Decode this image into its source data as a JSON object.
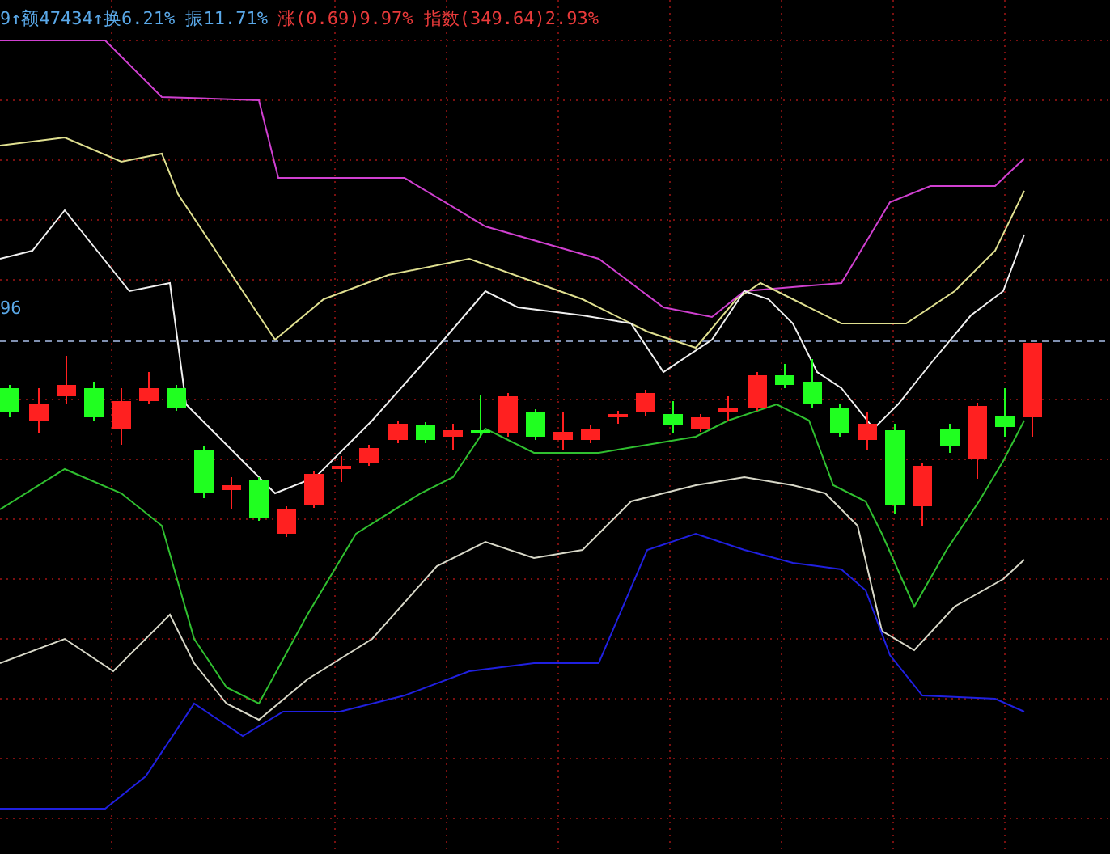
{
  "stats_line": {
    "segments": [
      {
        "kind": "volume",
        "text": "9↑额47434↑换6.21% 振11.71%"
      },
      {
        "kind": "change",
        "text": "涨(0.69)9.97% 指数(349.64)2.93%"
      }
    ]
  },
  "price_label": "96"
}
